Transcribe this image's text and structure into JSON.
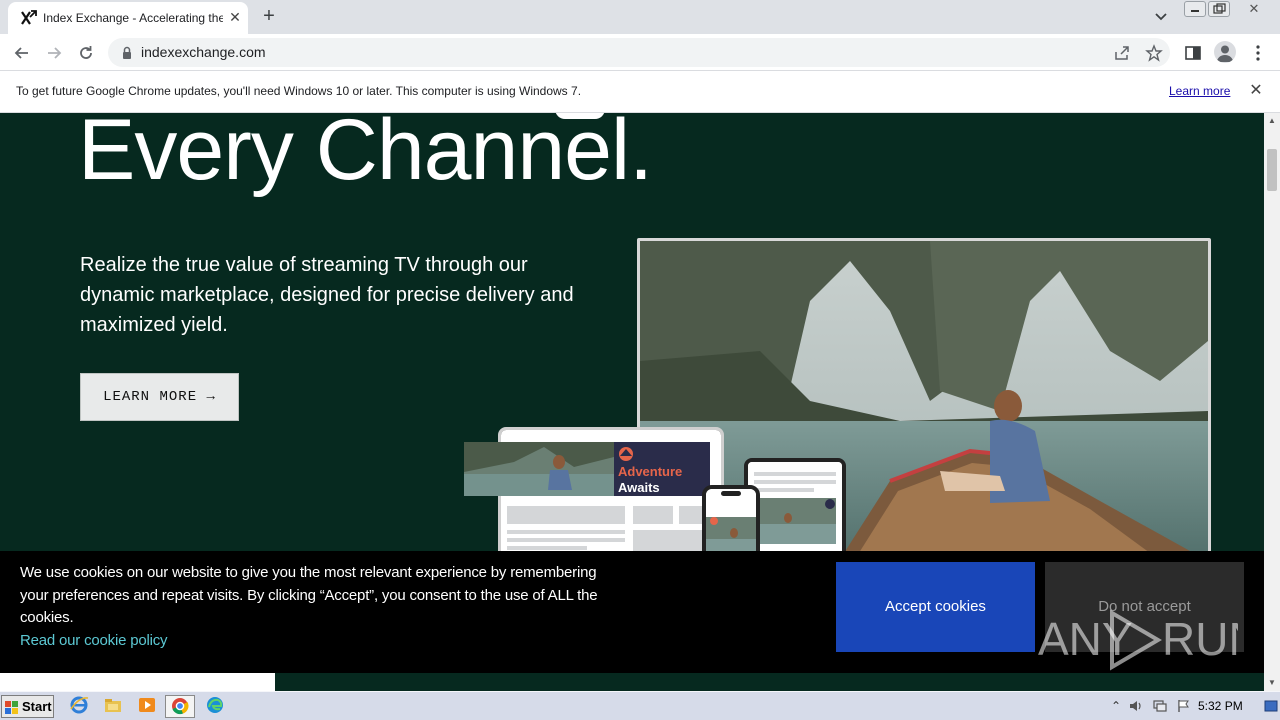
{
  "browser": {
    "tab": {
      "title": "Index Exchange - Accelerating the E",
      "favicon_text": "x",
      "close": "✕"
    },
    "new_tab": "+",
    "window_close": "✕",
    "url": "indexexchange.com"
  },
  "infobar": {
    "message": "To get future Google Chrome updates, you'll need Windows 10 or later. This computer is using Windows 7.",
    "learn_more": "Learn more",
    "close": "✕"
  },
  "hero": {
    "title": "Every Channel.",
    "body": "Realize the true value of streaming TV through our dynamic marketplace, designed for precise delivery and maximized yield.",
    "button_label": "LEARN MORE →",
    "ad_line1": "Adventure",
    "ad_line2": "Awaits"
  },
  "cookie": {
    "text": "We use cookies on our website to give you the most relevant experience by remembering your preferences and repeat visits. By clicking “Accept”, you consent to the use of ALL the cookies.",
    "policy_link": "Read our cookie policy",
    "accept": "Accept cookies",
    "reject": "Do not accept"
  },
  "watermark": {
    "text_left": "ANY",
    "text_right": "RUN"
  },
  "taskbar": {
    "start": "Start",
    "clock": "5:32 PM"
  },
  "colors": {
    "hero_bg": "#06291f",
    "accept_bg": "#1946b8",
    "cookie_link": "#5cc8d3",
    "ad_accent": "#e6654a"
  }
}
